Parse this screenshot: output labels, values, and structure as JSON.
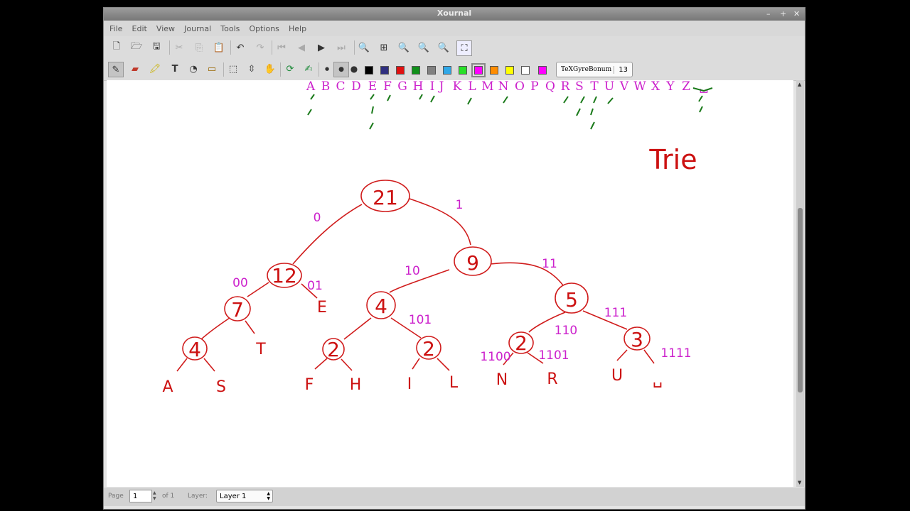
{
  "window": {
    "title": "Xournal"
  },
  "menu": [
    "File",
    "Edit",
    "View",
    "Journal",
    "Tools",
    "Options",
    "Help"
  ],
  "toolbar2": {
    "font_name": "TeXGyreBonum",
    "font_size": "13",
    "colors": [
      "#000000",
      "#303080",
      "#e01010",
      "#10901a",
      "#808080",
      "#30a8e8",
      "#28e028",
      "#ff00ff",
      "#ff8c00",
      "#ffff00",
      "#ffffff",
      "#ff00ff"
    ]
  },
  "status": {
    "page_label": "Page",
    "page_value": "1",
    "page_of": "of 1",
    "layer_label": "Layer:",
    "layer_value": "Layer 1"
  },
  "note": {
    "alphabet": [
      "A",
      "B",
      "C",
      "D",
      "E",
      "F",
      "G",
      "H",
      "I",
      "J",
      "K",
      "L",
      "M",
      "N",
      "O",
      "P",
      "Q",
      "R",
      "S",
      "T",
      "U",
      "V",
      "W",
      "X",
      "Y",
      "Z",
      "␣"
    ],
    "title_text": "Trie",
    "nodes": [
      "21",
      "12",
      "9",
      "7",
      "4",
      "5",
      "4",
      "2",
      "2",
      "2",
      "3"
    ],
    "leaves": [
      "E",
      "T",
      "A",
      "S",
      "F",
      "H",
      "I",
      "L",
      "N",
      "R",
      "U",
      "␣"
    ],
    "edge_labels": [
      "0",
      "1",
      "00",
      "01",
      "10",
      "11",
      "101",
      "110",
      "111",
      "1100",
      "1101",
      "1111"
    ]
  }
}
